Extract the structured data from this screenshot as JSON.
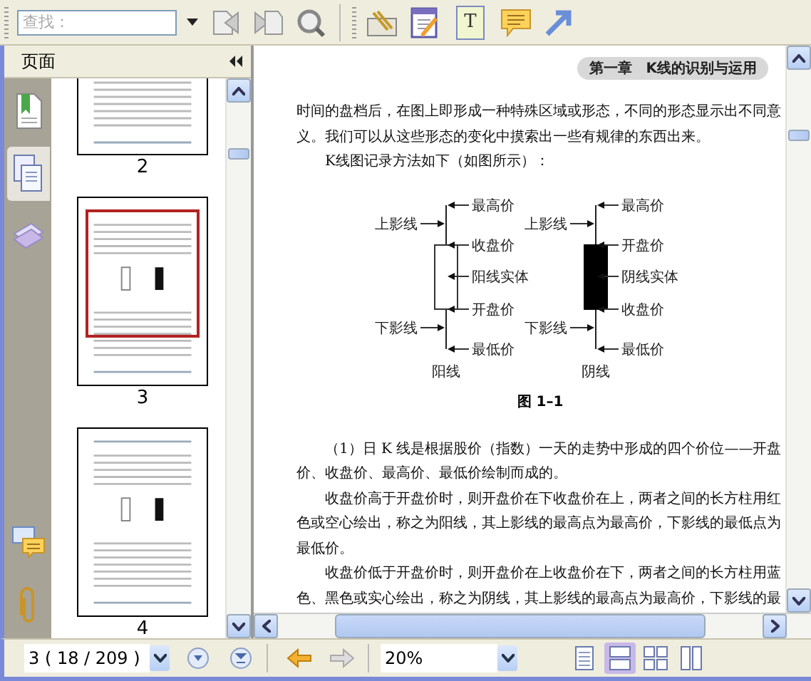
{
  "toolbar": {
    "search": {
      "placeholder": "查找："
    },
    "text_tool_glyph": "T"
  },
  "sidebar": {
    "title": "页面",
    "tabs": [
      {
        "kind": "bookmarks",
        "selected": false
      },
      {
        "kind": "pages",
        "selected": true
      },
      {
        "kind": "layers",
        "selected": false
      }
    ],
    "thumbnails": [
      {
        "label": "2",
        "selected": false
      },
      {
        "label": "3",
        "selected": true
      },
      {
        "label": "4",
        "selected": false
      }
    ]
  },
  "document": {
    "header": "第一章　K线的识别与运用",
    "paragraphs_before": [
      {
        "text": "时间的盘档后，在图上即形成一种特殊区域或形态，不同的形态显示出不同意义。我们可以从这些形态的变化中摸索出一些有规律的东西出来。",
        "indent": false
      },
      {
        "text": "K线图记录方法如下（如图所示）：",
        "indent": true
      }
    ],
    "diagram": {
      "candles": [
        {
          "kind": "hollow",
          "caption": "阳线",
          "upper_shadow": "上影线",
          "lower_shadow": "下影线",
          "high": "最高价",
          "body_top": "收盘价",
          "body": "阳线实体",
          "body_bottom": "开盘价",
          "low": "最低价"
        },
        {
          "kind": "solid",
          "caption": "阴线",
          "upper_shadow": "上影线",
          "lower_shadow": "下影线",
          "high": "最高价",
          "body_top": "开盘价",
          "body": "阴线实体",
          "body_bottom": "收盘价",
          "low": "最低价"
        }
      ]
    },
    "caption": "图 1–1",
    "paragraphs_after": [
      {
        "text": "（1）日 K 线是根据股价（指数）一天的走势中形成的四个价位——开盘价、收盘价、最高价、最低价绘制而成的。",
        "indent": true
      },
      {
        "text": "收盘价高于开盘价时，则开盘价在下收盘价在上，两者之间的长方柱用红色或空心绘出，称之为阳线，其上影线的最高点为最高价，下影线的最低点为最低价。",
        "indent": true
      },
      {
        "text": "收盘价低于开盘价时，则开盘价在上收盘价在下，两者之间的长方柱用蓝色、黑色或实心绘出，称之为阴线，其上影线的最高点为最高价，下影线的最",
        "indent": true
      }
    ]
  },
  "navigation": {
    "page": "3 ( 18 / 209 )",
    "zoom": "20%",
    "view_modes": [
      {
        "kind": "single",
        "selected": false
      },
      {
        "kind": "continuous",
        "selected": true
      },
      {
        "kind": "facing",
        "selected": false
      },
      {
        "kind": "continuous-facing",
        "selected": false
      }
    ]
  }
}
